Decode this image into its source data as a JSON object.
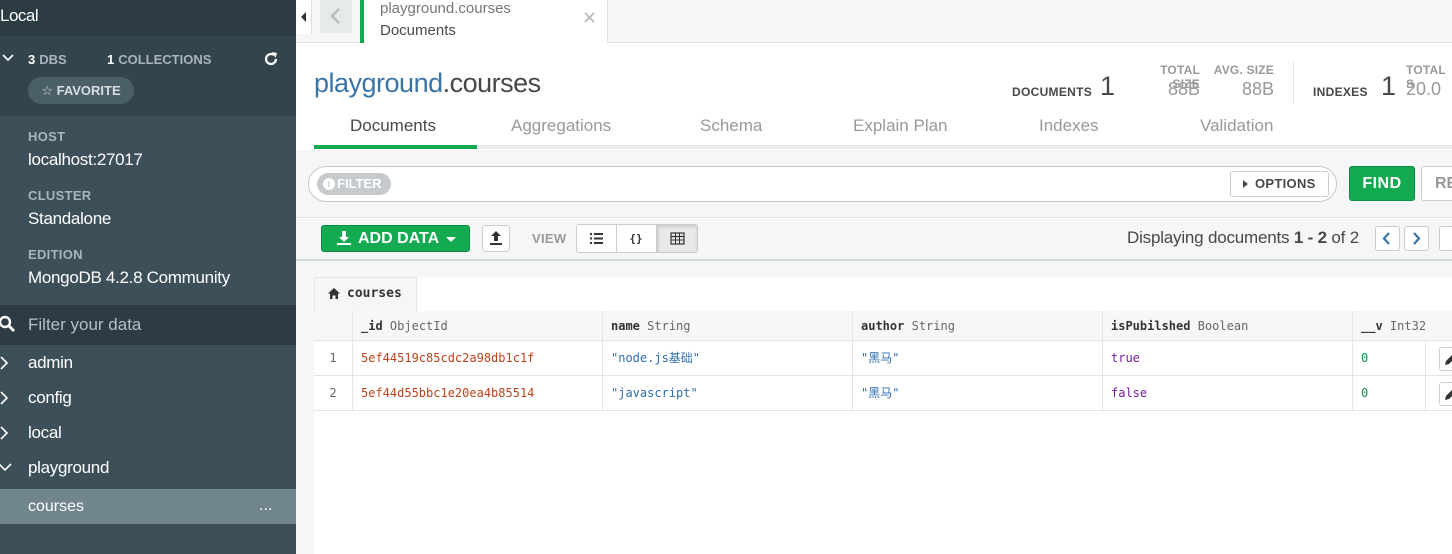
{
  "sidebar": {
    "title": "Local",
    "dbs_count": "3",
    "dbs_label": "DBS",
    "collections_count": "1",
    "collections_label": "COLLECTIONS",
    "favorite_label": "FAVORITE",
    "host_label": "HOST",
    "host_value": "localhost:27017",
    "cluster_label": "CLUSTER",
    "cluster_value": "Standalone",
    "edition_label": "EDITION",
    "edition_value": "MongoDB 4.2.8 Community",
    "filter_placeholder": "Filter your data",
    "databases": [
      {
        "name": "admin",
        "expanded": false
      },
      {
        "name": "config",
        "expanded": false
      },
      {
        "name": "local",
        "expanded": false
      },
      {
        "name": "playground",
        "expanded": true
      }
    ],
    "active_collection": "courses",
    "collection_menu": "..."
  },
  "tab": {
    "namespace": "playground.courses",
    "subtitle": "Documents"
  },
  "header": {
    "db": "playground",
    "coll": ".courses",
    "documents_label": "DOCUMENTS",
    "documents_value": "1",
    "total_size_label": "TOTAL SIZE",
    "total_size_value": "88B",
    "avg_size_label": "AVG. SIZE",
    "avg_size_value": "88B",
    "indexes_label": "INDEXES",
    "indexes_value": "1",
    "idx_total_label": "TOTAL S",
    "idx_total_value": "20.0"
  },
  "subtabs": [
    "Documents",
    "Aggregations",
    "Schema",
    "Explain Plan",
    "Indexes",
    "Validation"
  ],
  "query": {
    "filter_label": "FILTER",
    "options_label": "OPTIONS",
    "find_label": "FIND",
    "reset_label": "RE"
  },
  "toolbar": {
    "add_data_label": "ADD DATA",
    "view_label": "VIEW",
    "display_prefix": "Displaying documents ",
    "display_range": "1 - 2",
    "display_of": " of 2"
  },
  "grid": {
    "collection_tab": "courses",
    "columns": [
      {
        "field": "_id",
        "type": "ObjectId"
      },
      {
        "field": "name",
        "type": "String"
      },
      {
        "field": "author",
        "type": "String"
      },
      {
        "field": "isPubilshed",
        "type": "Boolean"
      },
      {
        "field": "__v",
        "type": "Int32"
      }
    ],
    "rows": [
      {
        "idx": "1",
        "id": "5ef44519c85cdc2a98db1c1f",
        "name": "\"node.js基础\"",
        "author": "\"黑马\"",
        "published": "true",
        "v": "0"
      },
      {
        "idx": "2",
        "id": "5ef44d55bbc1e20ea4b85514",
        "name": "\"javascript\"",
        "author": "\"黑马\"",
        "published": "false",
        "v": "0"
      }
    ]
  },
  "colors": {
    "accent_green": "#13aa52",
    "sidebar_bg": "#3d4f58",
    "db_name_blue": "#3b75a8",
    "objectid_red": "#c0421c",
    "string_blue": "#2f6eb0",
    "boolean_purple": "#751b9e",
    "int_green": "#1a8c4a"
  },
  "icons": [
    "chevron-down-icon",
    "refresh-icon",
    "star-icon",
    "search-icon",
    "chevron-right-icon",
    "back-arrow-icon",
    "close-icon",
    "info-icon",
    "download-icon",
    "export-icon",
    "list-view-icon",
    "json-view-icon",
    "table-view-icon",
    "home-icon",
    "pencil-icon"
  ]
}
